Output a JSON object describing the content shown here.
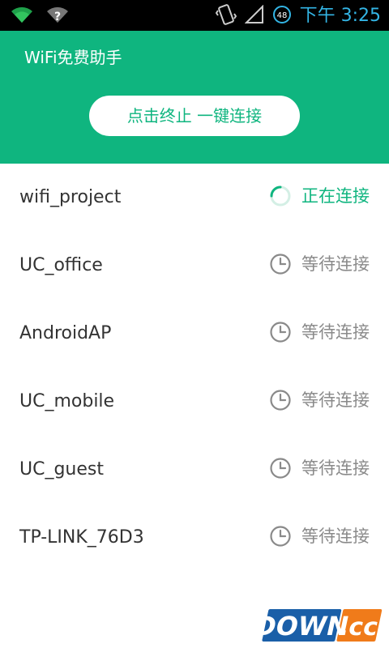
{
  "status_bar": {
    "time": "下午 3:25",
    "battery": "48"
  },
  "header": {
    "title": "WiFi免费助手",
    "button_label": "点击终止 一键连接"
  },
  "networks": [
    {
      "ssid": "wifi_project",
      "status": "正在连接",
      "icon": "spinner-icon"
    },
    {
      "ssid": "UC_office",
      "status": "等待连接",
      "icon": "clock-icon"
    },
    {
      "ssid": "AndroidAP",
      "status": "等待连接",
      "icon": "clock-icon"
    },
    {
      "ssid": "UC_mobile",
      "status": "等待连接",
      "icon": "clock-icon"
    },
    {
      "ssid": "UC_guest",
      "status": "等待连接",
      "icon": "clock-icon"
    },
    {
      "ssid": "TP-LINK_76D3",
      "status": "等待连接",
      "icon": "clock-icon"
    }
  ],
  "watermark": {
    "text_main": "DOWN",
    "text_accent": ".cc"
  },
  "colors": {
    "brand_green": "#0fb57f",
    "status_bar_bg": "#000000",
    "time_blue": "#33b5e5",
    "waiting_gray": "#8a8a8a"
  }
}
